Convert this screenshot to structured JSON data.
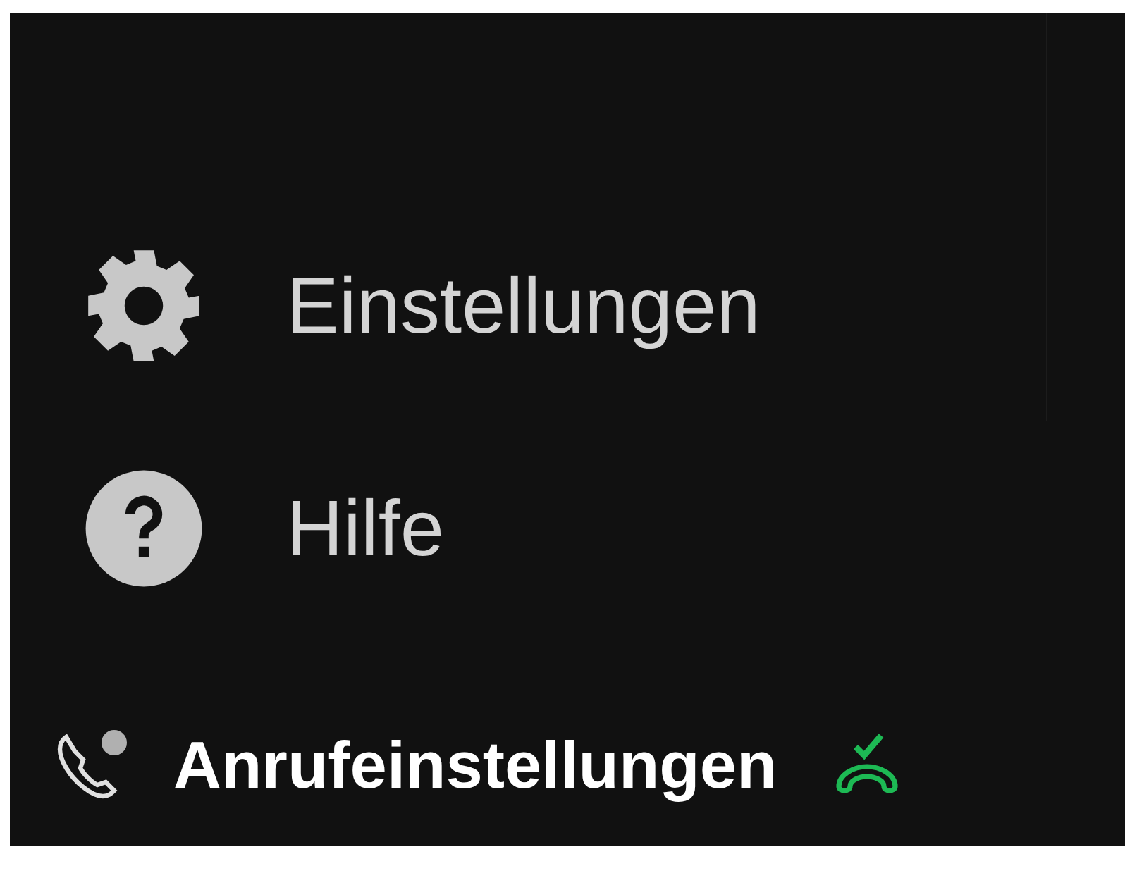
{
  "menu": [
    {
      "kind": "settings",
      "label": "Einstellungen"
    },
    {
      "kind": "help",
      "label": "Hilfe"
    }
  ],
  "footer": {
    "label": "Anrufeinstellungen",
    "connected": true
  }
}
